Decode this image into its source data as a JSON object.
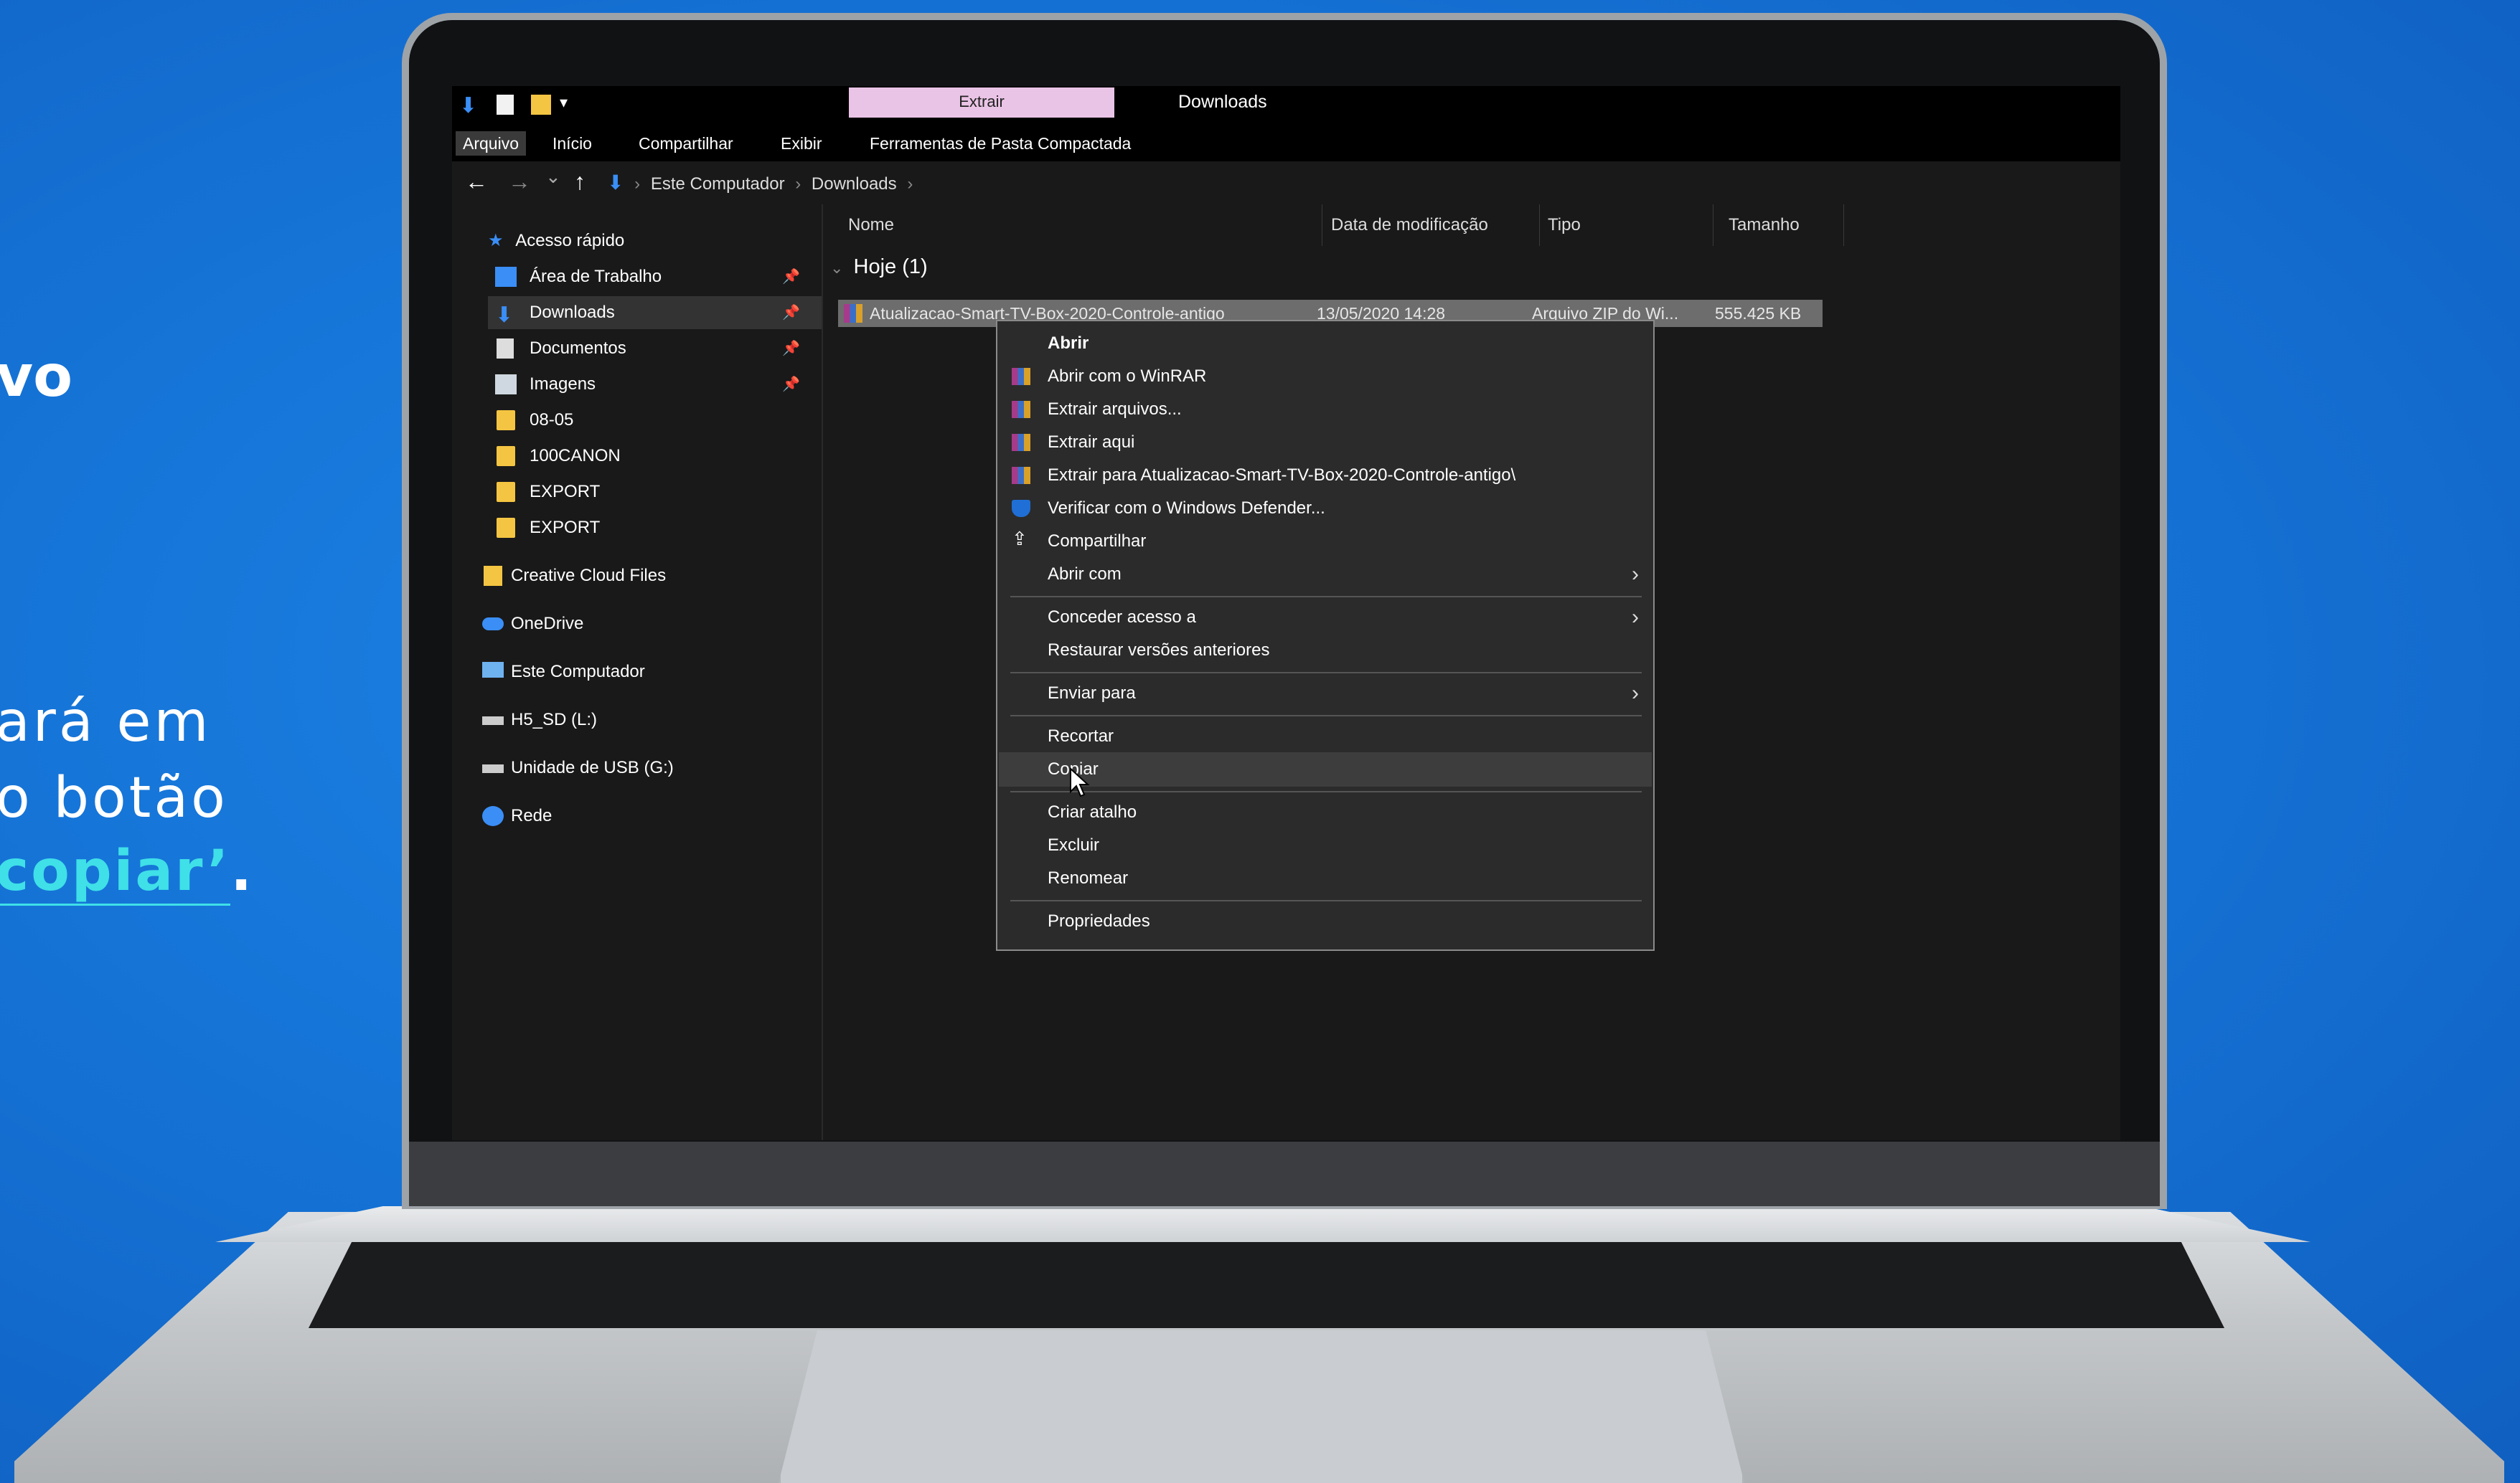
{
  "caption": {
    "line1_fragment": "vo",
    "line2": "ará em",
    "line3": "o botão",
    "line4_highlight": "copiar’",
    "line4_end": "."
  },
  "explorer": {
    "window_title": "Downloads",
    "contextual_tab": "Extrair",
    "ribbon_tabs": [
      "Arquivo",
      "Início",
      "Compartilhar",
      "Exibir",
      "Ferramentas de Pasta Compactada"
    ],
    "breadcrumb": [
      "Este Computador",
      "Downloads"
    ],
    "nav_buttons": {
      "back": "←",
      "forward": "→",
      "recent": "⌄",
      "up": "↑"
    },
    "sidebar": {
      "quick_access": "Acesso rápido",
      "items": [
        {
          "label": "Área de Trabalho",
          "icon": "desktop-icon",
          "pinned": true
        },
        {
          "label": "Downloads",
          "icon": "download-icon",
          "pinned": true,
          "selected": true
        },
        {
          "label": "Documentos",
          "icon": "document-icon",
          "pinned": true
        },
        {
          "label": "Imagens",
          "icon": "image-icon",
          "pinned": true
        },
        {
          "label": "08-05",
          "icon": "folder-icon"
        },
        {
          "label": "100CANON",
          "icon": "folder-icon"
        },
        {
          "label": "EXPORT",
          "icon": "folder-icon"
        },
        {
          "label": "EXPORT",
          "icon": "folder-icon"
        }
      ],
      "roots": [
        {
          "label": "Creative Cloud Files",
          "icon": "creative-cloud-icon"
        },
        {
          "label": "OneDrive",
          "icon": "cloud-icon"
        },
        {
          "label": "Este Computador",
          "icon": "computer-icon"
        },
        {
          "label": "H5_SD (L:)",
          "icon": "drive-icon"
        },
        {
          "label": "Unidade de USB (G:)",
          "icon": "drive-icon"
        },
        {
          "label": "Rede",
          "icon": "network-icon"
        }
      ]
    },
    "columns": [
      "Nome",
      "Data de modificação",
      "Tipo",
      "Tamanho"
    ],
    "group_header": "Hoje (1)",
    "file": {
      "name": "Atualizacao-Smart-TV-Box-2020-Controle-antigo",
      "modified": "13/05/2020 14:28",
      "type": "Arquivo ZIP do Wi...",
      "size": "555.425 KB"
    },
    "context_menu": [
      {
        "label": "Abrir",
        "bold": true
      },
      {
        "label": "Abrir com o WinRAR",
        "icon": "winrar-icon"
      },
      {
        "label": "Extrair arquivos...",
        "icon": "winrar-icon"
      },
      {
        "label": "Extrair aqui",
        "icon": "winrar-icon"
      },
      {
        "label": "Extrair para Atualizacao-Smart-TV-Box-2020-Controle-antigo\\",
        "icon": "winrar-icon"
      },
      {
        "label": "Verificar com o Windows Defender...",
        "icon": "shield-icon"
      },
      {
        "label": "Compartilhar",
        "icon": "share-icon"
      },
      {
        "label": "Abrir com",
        "submenu": true
      },
      {
        "label": "Conceder acesso a",
        "submenu": true
      },
      {
        "label": "Restaurar versões anteriores"
      },
      {
        "label": "Enviar para",
        "submenu": true
      },
      {
        "label": "Recortar"
      },
      {
        "label": "Copiar",
        "hovered": true
      },
      {
        "label": "Criar atalho"
      },
      {
        "label": "Excluir"
      },
      {
        "label": "Renomear"
      },
      {
        "label": "Propriedades"
      }
    ]
  },
  "colors": {
    "background": "#1675d8",
    "caption_highlight": "#3fe0e8",
    "contextual_tab": "#eac4e6"
  }
}
